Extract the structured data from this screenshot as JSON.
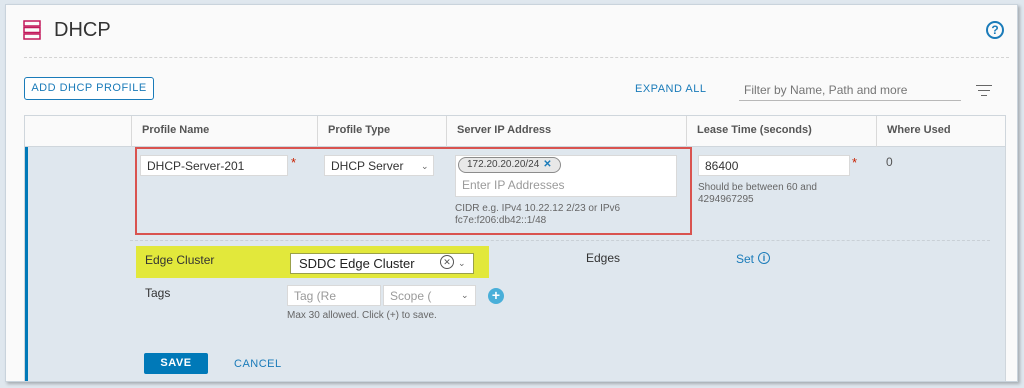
{
  "header": {
    "title": "DHCP",
    "help_icon": "?"
  },
  "toolbar": {
    "add_label": "ADD DHCP PROFILE",
    "expand_label": "EXPAND ALL",
    "filter_placeholder": "Filter by Name, Path and more"
  },
  "table": {
    "columns": [
      "Profile Name",
      "Profile Type",
      "Server IP Address",
      "Lease Time (seconds)",
      "Where Used"
    ]
  },
  "row": {
    "profile_name": "DHCP-Server-201",
    "profile_type": "DHCP Server",
    "server_ip_chip": "172.20.20.20/24",
    "server_ip_placeholder": "Enter IP Addresses",
    "server_ip_hint": "CIDR e.g. IPv4 10.22.12 2/23 or IPv6 fc7e:f206:db42::1/48",
    "lease_time": "86400",
    "lease_hint": "Should be between 60 and 4294967295",
    "where_used": "0",
    "edge_cluster_label": "Edge Cluster",
    "edge_cluster_value": "SDDC Edge Cluster",
    "edges_label": "Edges",
    "edges_set": "Set",
    "tags_label": "Tags",
    "tag_placeholder": "Tag (Re",
    "scope_placeholder": "Scope (",
    "tags_hint": "Max 30 allowed. Click (+) to save."
  },
  "actions": {
    "save": "SAVE",
    "cancel": "CANCEL"
  },
  "colors": {
    "accent": "#0079b8",
    "required": "#c92100",
    "highlight": "#e2e83b",
    "annotation": "#d9534f"
  }
}
